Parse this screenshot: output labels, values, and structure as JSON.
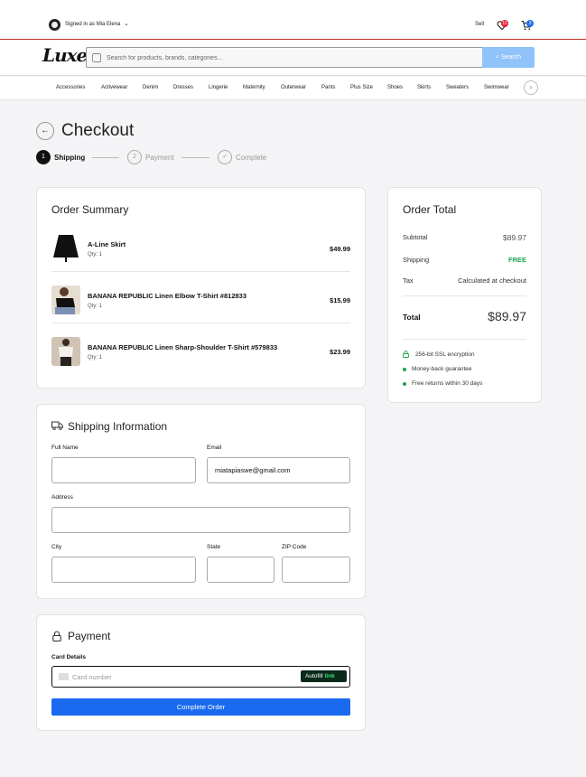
{
  "topbar": {
    "signed_in": "Signed in as Mia Elena",
    "sell": "Sell",
    "wishlist_count": "11",
    "cart_count": "3"
  },
  "header": {
    "logo": "Luxe",
    "search_placeholder": "Search for products, brands, categories...",
    "search_button": "Search"
  },
  "categories": [
    "Accessories",
    "Activewear",
    "Denim",
    "Dresses",
    "Lingerie",
    "Maternity",
    "Outerwear",
    "Pants",
    "Plus Size",
    "Shoes",
    "Skirts",
    "Sweaters",
    "Swimwear"
  ],
  "checkout": {
    "title": "Checkout",
    "steps": [
      {
        "number": "1",
        "label": "Shipping"
      },
      {
        "number": "2",
        "label": "Payment"
      },
      {
        "number": "✓",
        "label": "Complete"
      }
    ]
  },
  "order_summary": {
    "title": "Order Summary",
    "items": [
      {
        "name": "A-Line Skirt",
        "qty": "Qty: 1",
        "price": "$49.99"
      },
      {
        "name": "BANANA REPUBLIC Linen Elbow T-Shirt #812833",
        "qty": "Qty: 1",
        "price": "$15.99"
      },
      {
        "name": "BANANA REPUBLIC Linen Sharp-Shoulder T-Shirt #579833",
        "qty": "Qty: 1",
        "price": "$23.99"
      }
    ]
  },
  "shipping": {
    "title": "Shipping Information",
    "full_name_label": "Full Name",
    "full_name_value": "",
    "email_label": "Email",
    "email_value": "miatapiaswe@gmail.com",
    "address_label": "Address",
    "address_value": "",
    "city_label": "City",
    "city_value": "",
    "state_label": "State",
    "state_value": "",
    "zip_label": "ZIP Code",
    "zip_value": ""
  },
  "payment": {
    "title": "Payment",
    "card_label": "Card Details",
    "card_placeholder": "Card number",
    "autofill": "Autofill",
    "autofill_link": "link",
    "submit": "Complete Order"
  },
  "order_total": {
    "title": "Order Total",
    "subtotal_label": "Subtotal",
    "subtotal_value": "$89.97",
    "shipping_label": "Shipping",
    "shipping_value": "FREE",
    "tax_label": "Tax",
    "tax_value": "Calculated at checkout",
    "total_label": "Total",
    "total_value": "$89.97",
    "trust": [
      "256-bit SSL encryption",
      "Money-back guarantee",
      "Free returns within 30 days"
    ]
  },
  "colors": {
    "accent_blue": "#1a6af0",
    "free_green": "#1aa64b",
    "search_button": "#8fc3f9"
  }
}
